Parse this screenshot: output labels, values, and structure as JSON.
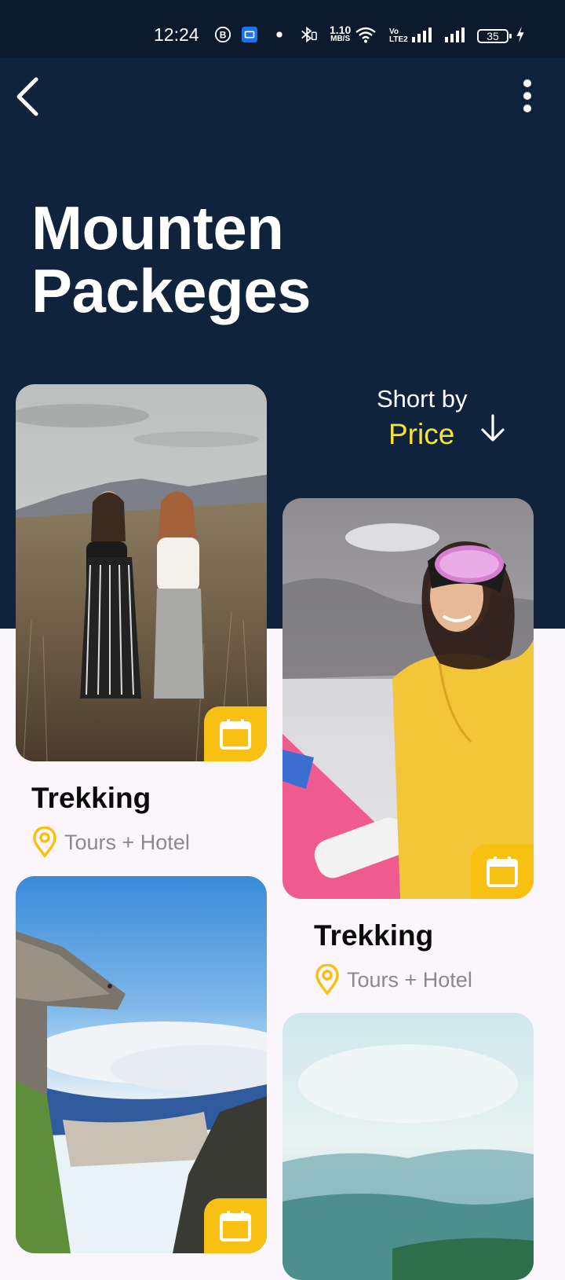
{
  "status": {
    "time": "12:24",
    "speed_top": "1.10",
    "speed_unit": "MB/S",
    "volte_top": "Vo",
    "volte_bottom": "LTE2",
    "battery": "35"
  },
  "header": {
    "title_line1": "Mounten",
    "title_line2": "Packeges"
  },
  "sort": {
    "label": "Short by",
    "value": "Price"
  },
  "packages": [
    {
      "title": "Trekking",
      "meta": "Tours + Hotel"
    },
    {
      "title": "Trekking",
      "meta": "Tours + Hotel"
    }
  ],
  "colors": {
    "hero": "#10233c",
    "accent_yellow": "#f8c012",
    "sort_value": "#f6e23c",
    "page_bg": "#fbf6fc"
  }
}
